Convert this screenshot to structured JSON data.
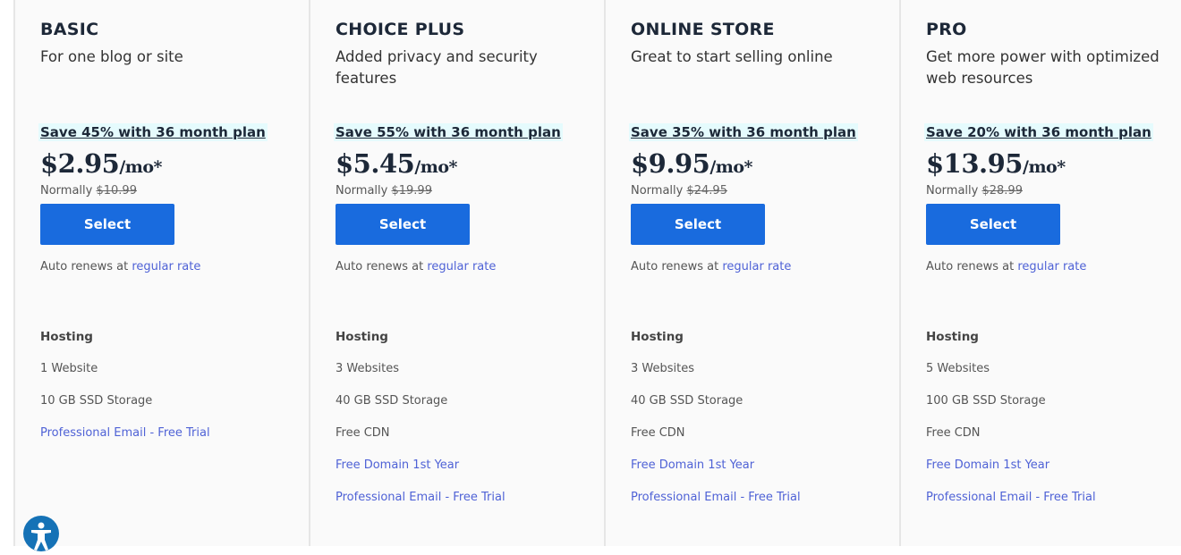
{
  "plans": [
    {
      "name": "BASIC",
      "desc": "For one blog or site",
      "save": "Save 45% with 36 month plan",
      "price": "$2.95",
      "per": "/mo*",
      "normally": "Normally",
      "old": "$10.99",
      "select": "Select",
      "renew": "Auto renews at",
      "renew_link": "regular rate",
      "features_title": "Hosting",
      "features": [
        {
          "t": "1 Website",
          "link": false
        },
        {
          "t": "10 GB SSD Storage",
          "link": false
        },
        {
          "t": "Professional Email - Free Trial",
          "link": true
        }
      ]
    },
    {
      "name": "CHOICE PLUS",
      "desc": "Added privacy and security features",
      "save": "Save 55% with 36 month plan",
      "price": "$5.45",
      "per": "/mo*",
      "normally": "Normally",
      "old": "$19.99",
      "select": "Select",
      "renew": "Auto renews at",
      "renew_link": "regular rate",
      "features_title": "Hosting",
      "features": [
        {
          "t": "3 Websites",
          "link": false
        },
        {
          "t": "40 GB SSD Storage",
          "link": false
        },
        {
          "t": "Free CDN",
          "link": false
        },
        {
          "t": "Free Domain 1st Year",
          "link": true
        },
        {
          "t": "Professional Email - Free Trial",
          "link": true
        }
      ]
    },
    {
      "name": "ONLINE STORE",
      "desc": "Great to start selling online",
      "save": "Save 35% with 36 month plan",
      "price": "$9.95",
      "per": "/mo*",
      "normally": "Normally",
      "old": "$24.95",
      "select": "Select",
      "renew": "Auto renews at",
      "renew_link": "regular rate",
      "features_title": "Hosting",
      "features": [
        {
          "t": "3 Websites",
          "link": false
        },
        {
          "t": "40 GB SSD Storage",
          "link": false
        },
        {
          "t": "Free CDN",
          "link": false
        },
        {
          "t": "Free Domain 1st Year",
          "link": true
        },
        {
          "t": "Professional Email - Free Trial",
          "link": true
        }
      ]
    },
    {
      "name": "PRO",
      "desc": "Get more power with optimized web resources",
      "save": "Save 20% with 36 month plan",
      "price": "$13.95",
      "per": "/mo*",
      "normally": "Normally",
      "old": "$28.99",
      "select": "Select",
      "renew": "Auto renews at",
      "renew_link": "regular rate",
      "features_title": "Hosting",
      "features": [
        {
          "t": "5 Websites",
          "link": false
        },
        {
          "t": "100 GB SSD Storage",
          "link": false
        },
        {
          "t": "Free CDN",
          "link": false
        },
        {
          "t": "Free Domain 1st Year",
          "link": true
        },
        {
          "t": "Professional Email - Free Trial",
          "link": true
        }
      ]
    }
  ],
  "colors": {
    "button": "#196bde",
    "link": "#4f62d6",
    "save_bg": "#e5fbfd"
  },
  "accessibility_icon": "accessibility-icon"
}
